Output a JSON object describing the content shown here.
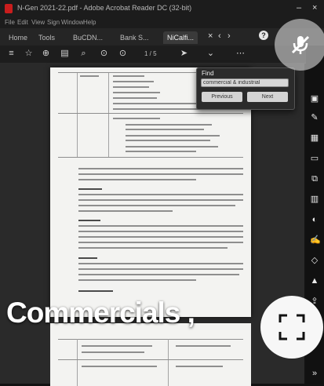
{
  "window": {
    "title": "N-Gen 2021-22.pdf - Adobe Acrobat Reader DC (32-bit)",
    "minimize": "–",
    "close": "×"
  },
  "menu": [
    "File",
    "Edit",
    "View",
    "Sign",
    "Window",
    "Help"
  ],
  "tabs": [
    {
      "label": "Home"
    },
    {
      "label": "Tools"
    },
    {
      "label": "BuCDN..."
    },
    {
      "label": "Bank S..."
    },
    {
      "label": "NiCalfi...",
      "active": true
    }
  ],
  "tab_controls": {
    "close": "×",
    "prev": "‹",
    "next": "›"
  },
  "help_label": "?",
  "toolbar": {
    "page_indicator": "1 / 5"
  },
  "find": {
    "label": "Find",
    "value": "commercial & industrial",
    "previous_label": "Previous",
    "next_label": "Next"
  },
  "overlay": {
    "caption": "Commercials ,"
  },
  "colors": {
    "background": "#121212",
    "page": "#f3f3f1",
    "overlay_button": "#f7f7f7",
    "pdf_red": "#c91d1d"
  }
}
